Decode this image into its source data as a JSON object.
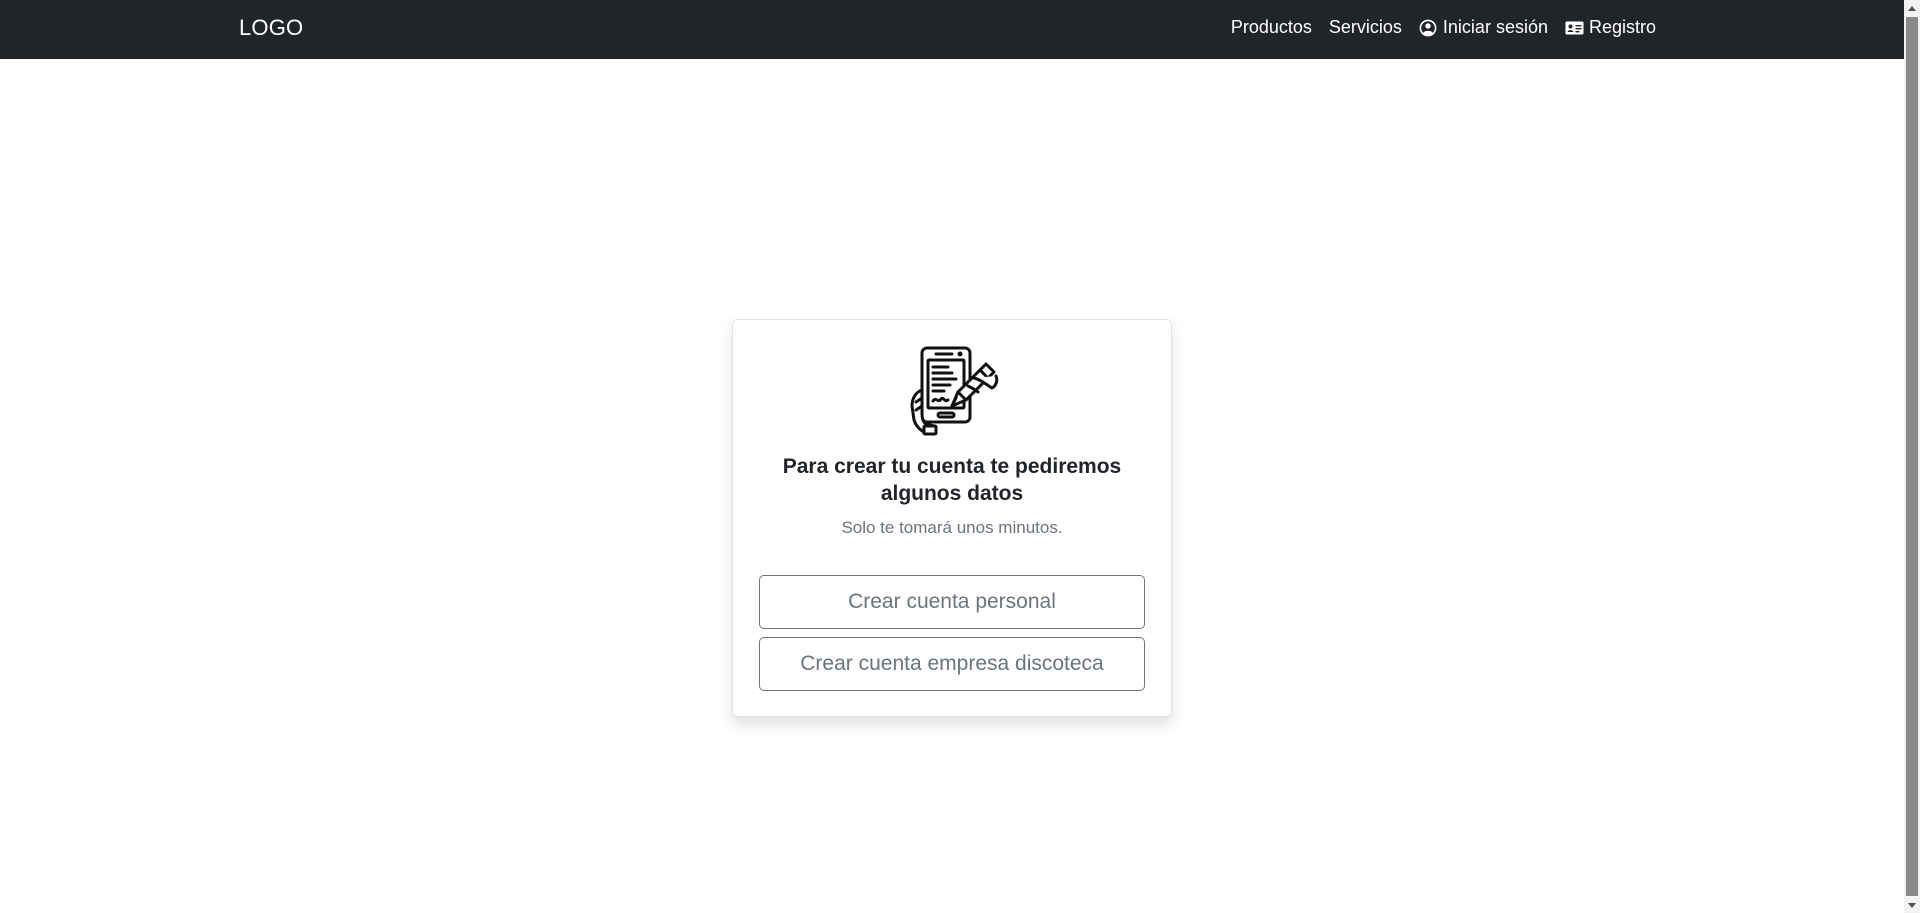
{
  "navbar": {
    "brand": "LOGO",
    "links": [
      {
        "label": "Productos",
        "icon": null
      },
      {
        "label": "Servicios",
        "icon": null
      },
      {
        "label": "Iniciar sesión",
        "icon": "user-circle-icon"
      },
      {
        "label": "Registro",
        "icon": "id-card-icon"
      }
    ],
    "background_color": "#212529"
  },
  "card": {
    "icon": "tablet-signing-icon",
    "title": "Para crear tu cuenta te pediremos algunos datos",
    "subtitle": "Solo te tomará unos minutos.",
    "buttons": {
      "personal": "Crear cuenta personal",
      "empresa": "Crear cuenta empresa discoteca"
    }
  },
  "colors": {
    "text_dark": "#212529",
    "text_muted": "#6c757d",
    "button_border": "#6c757d"
  }
}
